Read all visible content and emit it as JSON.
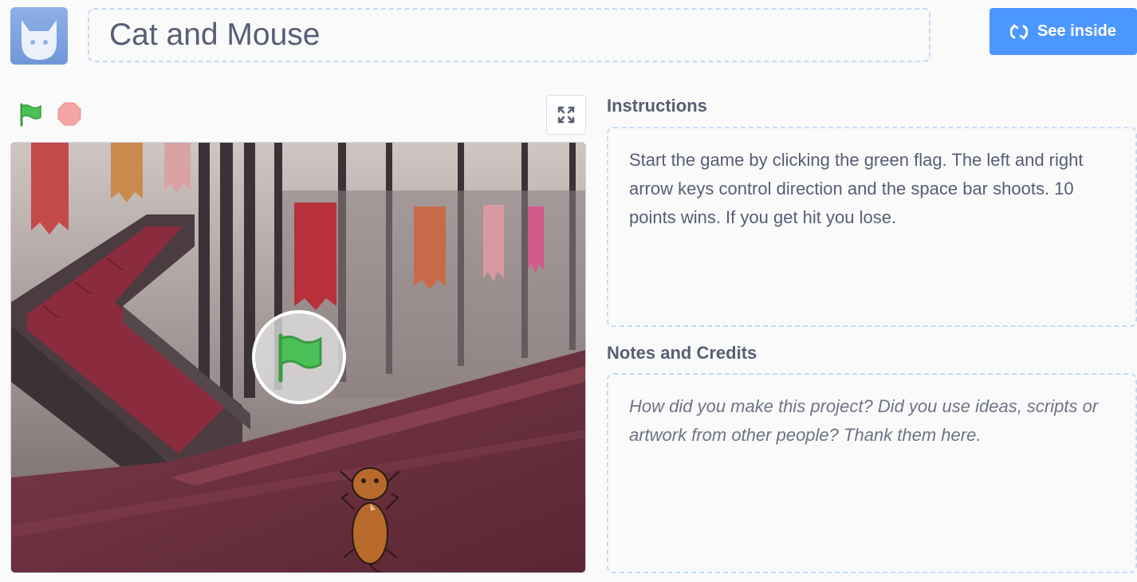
{
  "header": {
    "project_title": "Cat and Mouse",
    "see_inside_label": "See inside",
    "avatar_icon": "scratch-cat-avatar-icon"
  },
  "player": {
    "green_flag_icon": "green-flag-icon",
    "stop_icon": "stop-sign-icon",
    "fullscreen_icon": "fullscreen-expand-icon",
    "overlay_icon": "green-flag-play-overlay-icon",
    "sprite": "mouse-sprite"
  },
  "instructions": {
    "label": "Instructions",
    "text": "Start the game by clicking the green flag. The left and right arrow keys control direction and the space bar shoots. 10 points wins. If you get hit you lose."
  },
  "notes": {
    "label": "Notes and Credits",
    "placeholder": "How did you make this project? Did you use ideas, scripts or artwork from other people? Thank them here."
  },
  "colors": {
    "accent": "#4c97ff",
    "text": "#575e75",
    "dashed_border": "#c6daf5",
    "flag_green": "#4cbf56",
    "stop_red": "#f4a5a5"
  }
}
